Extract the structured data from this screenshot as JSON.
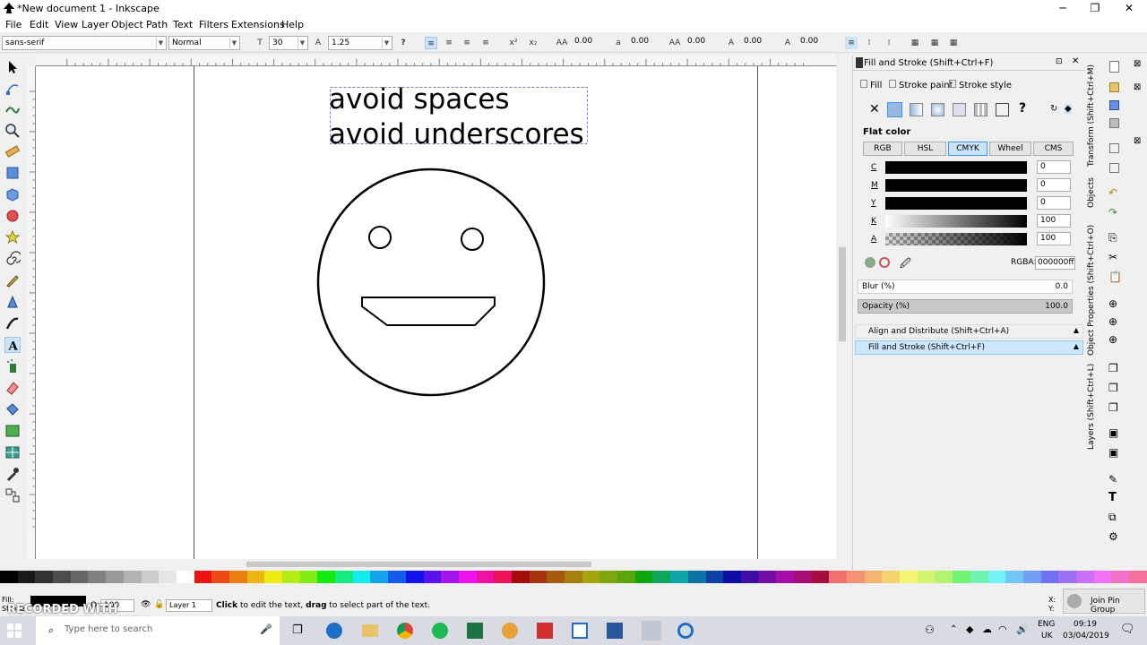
{
  "window": {
    "title": "*New document 1 - Inkscape",
    "minimize": "─",
    "maximize": "❐",
    "close": "✕"
  },
  "menu": [
    "File",
    "Edit",
    "View",
    "Layer",
    "Object",
    "Path",
    "Text",
    "Filters",
    "Extensions",
    "Help"
  ],
  "text_toolbar": {
    "font_family": "sans-serif",
    "font_style": "Normal",
    "font_size": "30",
    "line_spacing": "1.25",
    "letter_spacing": "0.00",
    "word_spacing": "0.00",
    "horiz_kern": "0.00",
    "vert_shift": "0.00",
    "rotation": "0.00"
  },
  "canvas": {
    "text_line1": "avoid spaces",
    "text_line2": "avoid underscores"
  },
  "fill_stroke": {
    "title": "Fill and Stroke (Shift+Ctrl+F)",
    "tab_fill": "Fill",
    "tab_stroke_paint": "Stroke paint",
    "tab_stroke_style": "Stroke style",
    "paint_mode": "Flat color",
    "color_modes": [
      "RGB",
      "HSL",
      "CMYK",
      "Wheel",
      "CMS"
    ],
    "active_mode": "CMYK",
    "channels": [
      {
        "label": "C",
        "value": "0"
      },
      {
        "label": "M",
        "value": "0"
      },
      {
        "label": "Y",
        "value": "0"
      },
      {
        "label": "K",
        "value": "100"
      },
      {
        "label": "A",
        "value": "100"
      }
    ],
    "rgba_label": "RGBA:",
    "rgba_value": "000000ff",
    "blur_label": "Blur (%)",
    "blur_value": "0.0",
    "opacity_label": "Opacity (%)",
    "opacity_value": "100.0",
    "dock_align": "Align and Distribute (Shift+Ctrl+A)",
    "dock_fill": "Fill and Stroke (Shift+Ctrl+F)"
  },
  "vertical_tabs": [
    "Transform (Shift+Ctrl+M)",
    "Objects",
    "Object Properties (Shift+Ctrl+O)",
    "Layers (Shift+Ctrl+L)"
  ],
  "statusbar": {
    "fill_label": "Fill:",
    "stroke_label": "Stroke:",
    "opacity_label": "O:",
    "opacity_value": "100",
    "layer": "Layer 1",
    "message_bold1": "Click",
    "message_mid": " to edit the text, ",
    "message_bold2": "drag",
    "message_end": " to select part of the text.",
    "x_label": "X:",
    "y_label": "Y:",
    "join_pin_group": "Join Pin Group"
  },
  "watermark": "RECORDED WITH SCREENCAST-O-MATIC",
  "taskbar": {
    "search_placeholder": "Type here to search",
    "lang": "ENG",
    "region": "UK",
    "time": "09:19",
    "date": "03/04/2019"
  },
  "colors": {
    "accent_blue": "#3399ff",
    "selected_mode": "#cce4f7",
    "dock_highlight": "#cce8ff"
  }
}
